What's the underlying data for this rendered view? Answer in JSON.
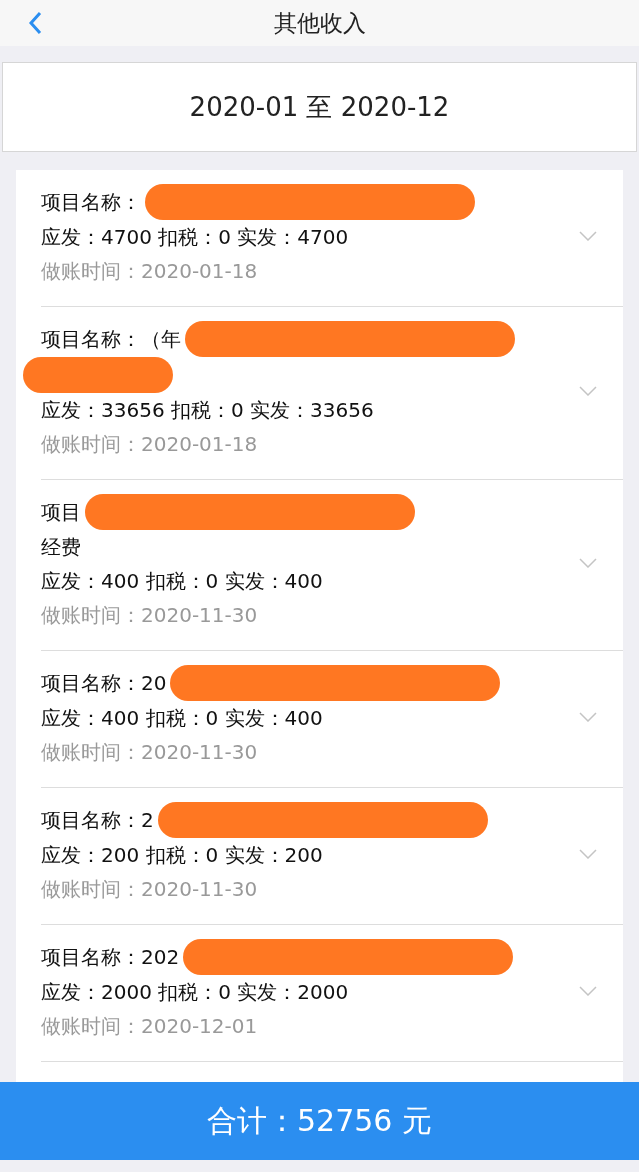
{
  "header": {
    "title": "其他收入"
  },
  "date_range": "2020-01 至 2020-12",
  "items": [
    {
      "name_lines": [
        {
          "text": "项目名称：",
          "redacted": true
        }
      ],
      "amounts": "应发：4700 扣税：0 实发：4700",
      "date": "做账时间：2020-01-18",
      "expanded": false
    },
    {
      "name_lines": [
        {
          "text": "项目名称：（年",
          "redacted": true
        },
        {
          "redacted": true
        }
      ],
      "amounts": "应发：33656 扣税：0 实发：33656",
      "date": "做账时间：2020-01-18",
      "expanded": false
    },
    {
      "name_lines": [
        {
          "text": "项目",
          "redacted": true
        },
        {
          "text": "经费"
        }
      ],
      "amounts": "应发：400 扣税：0 实发：400",
      "date": "做账时间：2020-11-30",
      "expanded": false
    },
    {
      "name_lines": [
        {
          "text": "项目名称：20",
          "redacted": true
        }
      ],
      "amounts": "应发：400 扣税：0 实发：400",
      "date": "做账时间：2020-11-30",
      "expanded": false
    },
    {
      "name_lines": [
        {
          "text": "项目名称：2",
          "redacted": true
        }
      ],
      "amounts": "应发：200 扣税：0 实发：200",
      "date": "做账时间：2020-11-30",
      "expanded": false
    },
    {
      "name_lines": [
        {
          "text": "项目名称：202",
          "redacted": true
        }
      ],
      "amounts": "应发：2000 扣税：0 实发：2000",
      "date": "做账时间：2020-12-01",
      "expanded": false
    }
  ],
  "total": "合计：52756 元"
}
